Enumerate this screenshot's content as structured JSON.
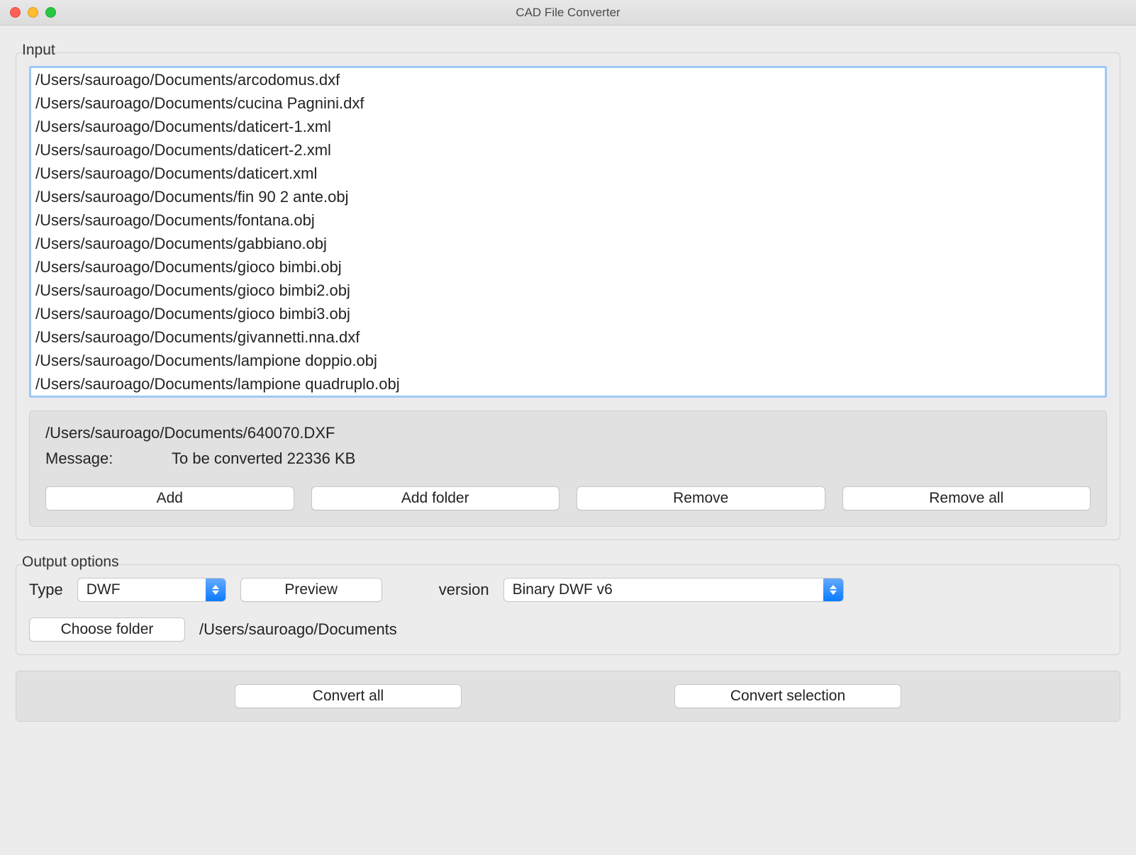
{
  "window": {
    "title": "CAD File Converter"
  },
  "input": {
    "group_label": "Input",
    "files": [
      "/Users/sauroago/Documents/arcodomus.dxf",
      "/Users/sauroago/Documents/cucina Pagnini.dxf",
      "/Users/sauroago/Documents/daticert-1.xml",
      "/Users/sauroago/Documents/daticert-2.xml",
      "/Users/sauroago/Documents/daticert.xml",
      "/Users/sauroago/Documents/fin 90 2 ante.obj",
      "/Users/sauroago/Documents/fontana.obj",
      "/Users/sauroago/Documents/gabbiano.obj",
      "/Users/sauroago/Documents/gioco bimbi.obj",
      "/Users/sauroago/Documents/gioco bimbi2.obj",
      "/Users/sauroago/Documents/gioco bimbi3.obj",
      "/Users/sauroago/Documents/givannetti.nna.dxf",
      "/Users/sauroago/Documents/lampione doppio.obj",
      "/Users/sauroago/Documents/lampione quadruplo.obj"
    ],
    "selected_path": "/Users/sauroago/Documents/640070.DXF",
    "message_label": "Message:",
    "message_value": "To be converted 22336 KB",
    "buttons": {
      "add": "Add",
      "add_folder": "Add folder",
      "remove": "Remove",
      "remove_all": "Remove all"
    }
  },
  "output": {
    "group_label": "Output options",
    "type_label": "Type",
    "type_value": "DWF",
    "preview_label": "Preview",
    "version_label": "version",
    "version_value": "Binary DWF v6",
    "choose_folder_label": "Choose folder",
    "folder_path": "/Users/sauroago/Documents"
  },
  "convert": {
    "all": "Convert all",
    "selection": "Convert selection"
  }
}
